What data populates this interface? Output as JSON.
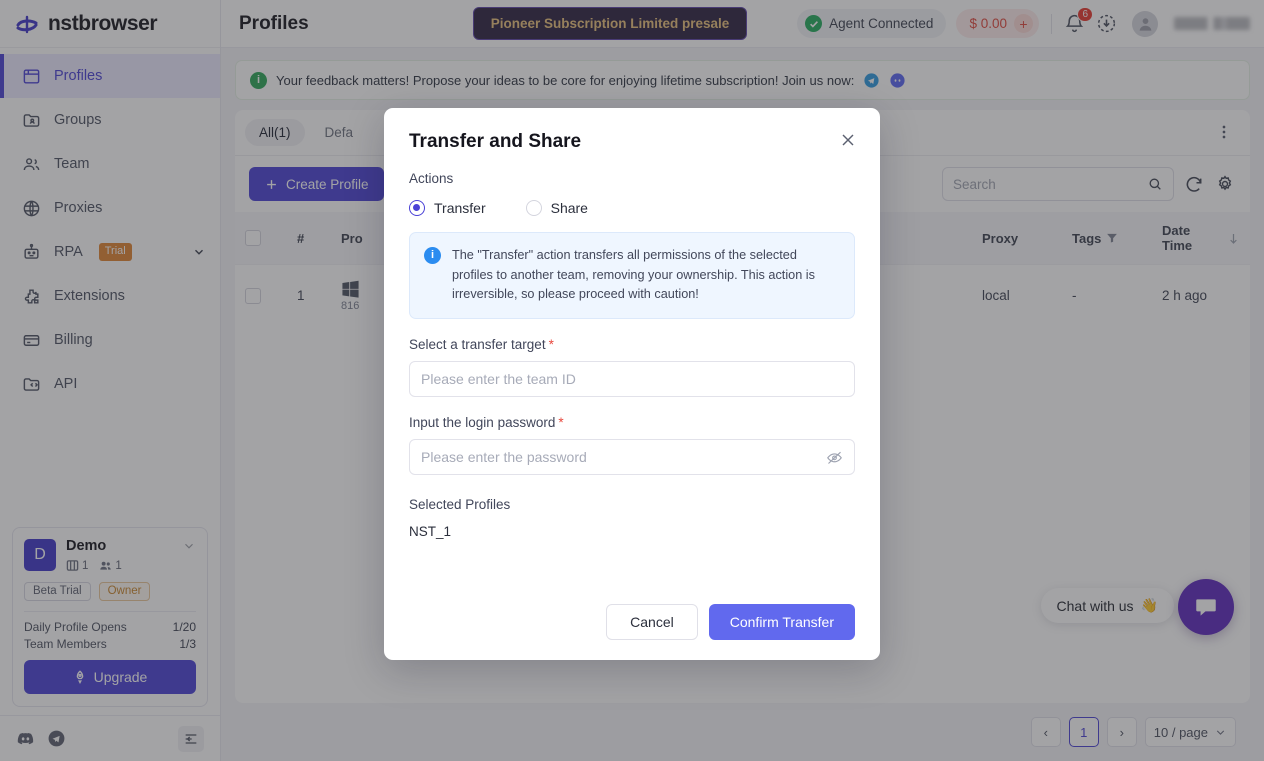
{
  "brand": {
    "name": "nstbrowser",
    "logo_icon": "nstbrowser-logo-icon"
  },
  "sidebar": {
    "items": [
      {
        "label": "Profiles",
        "icon": "browser-window-icon",
        "active": true
      },
      {
        "label": "Groups",
        "icon": "folder-user-icon",
        "active": false
      },
      {
        "label": "Team",
        "icon": "users-icon",
        "active": false
      },
      {
        "label": "Proxies",
        "icon": "globe-icon",
        "active": false
      },
      {
        "label": "RPA",
        "icon": "robot-icon",
        "active": false,
        "badge": "Trial",
        "chevron": "chevron-down-icon"
      },
      {
        "label": "Extensions",
        "icon": "puzzle-icon",
        "active": false
      },
      {
        "label": "Billing",
        "icon": "credit-card-icon",
        "active": false
      },
      {
        "label": "API",
        "icon": "folder-code-icon",
        "active": false
      }
    ],
    "account": {
      "avatar_letter": "D",
      "name": "Demo",
      "profiles_count": "1",
      "members_count": "1",
      "tags": [
        "Beta Trial",
        "Owner"
      ],
      "meters": [
        {
          "label": "Daily Profile Opens",
          "value": "1/20"
        },
        {
          "label": "Team Members",
          "value": "1/3"
        }
      ],
      "upgrade_label": "Upgrade"
    },
    "footer": {
      "discord_icon": "discord-icon",
      "telegram_icon": "telegram-icon",
      "collapse_icon": "collapse-sidebar-icon"
    }
  },
  "topbar": {
    "title": "Profiles",
    "presale_label": "Pioneer Subscription Limited presale",
    "agent_status": "Agent Connected",
    "balance": "$ 0.00",
    "add_funds": "+",
    "notifications_count": "6",
    "icons": {
      "bell": "bell-icon",
      "download": "download-icon",
      "avatar": "avatar-icon"
    }
  },
  "feedback": {
    "text": "Your feedback matters! Propose your ideas to be core for enjoying lifetime subscription! Join us now:",
    "telegram_icon": "telegram-icon",
    "discord_icon": "discord-icon"
  },
  "panel": {
    "tabs": [
      {
        "label": "All(1)",
        "active": true
      },
      {
        "label": "Defa",
        "active": false
      }
    ],
    "kebab_icon": "more-vertical-icon",
    "create_label": "Create Profile",
    "search": {
      "placeholder": "Search",
      "value": ""
    },
    "refresh_icon": "refresh-icon",
    "settings_icon": "gear-icon",
    "table": {
      "columns": [
        "",
        "#",
        "Pro",
        "Proxy",
        "Tags",
        "Date Time"
      ],
      "rows": [
        {
          "index": "1",
          "os_icon": "windows-icon",
          "os_sub": "816",
          "proxy": "local",
          "tags": "-",
          "datetime": "2 h ago"
        }
      ]
    },
    "pagination": {
      "prev": "‹",
      "pages": [
        "1"
      ],
      "next": "›",
      "page_size": "10 / page"
    }
  },
  "chat": {
    "label": "Chat with us",
    "emoji": "👋",
    "fab_icon": "chat-bubble-icon"
  },
  "modal": {
    "title": "Transfer and Share",
    "close_icon": "close-icon",
    "actions_label": "Actions",
    "options": [
      {
        "label": "Transfer",
        "selected": true
      },
      {
        "label": "Share",
        "selected": false
      }
    ],
    "notice": "The \"Transfer\" action transfers all permissions of the selected profiles to another team, removing your ownership. This action is irreversible, so please proceed with caution!",
    "target_label": "Select a transfer target",
    "target_required": "*",
    "target_placeholder": "Please enter the team ID",
    "target_value": "",
    "password_label": "Input the login password",
    "password_required": "*",
    "password_placeholder": "Please enter the password",
    "password_value": "",
    "eye_icon": "eye-off-icon",
    "selected_profiles_label": "Selected Profiles",
    "selected_profiles": [
      "NST_1"
    ],
    "cancel_label": "Cancel",
    "confirm_label": "Confirm Transfer"
  },
  "colors": {
    "brand_purple": "#4a41d6",
    "confirm_blue": "#6169ee",
    "accent_gold": "#e8c07a",
    "status_green": "#21ab5c",
    "danger_red": "#e8362c",
    "trial_orange": "#e08330"
  }
}
